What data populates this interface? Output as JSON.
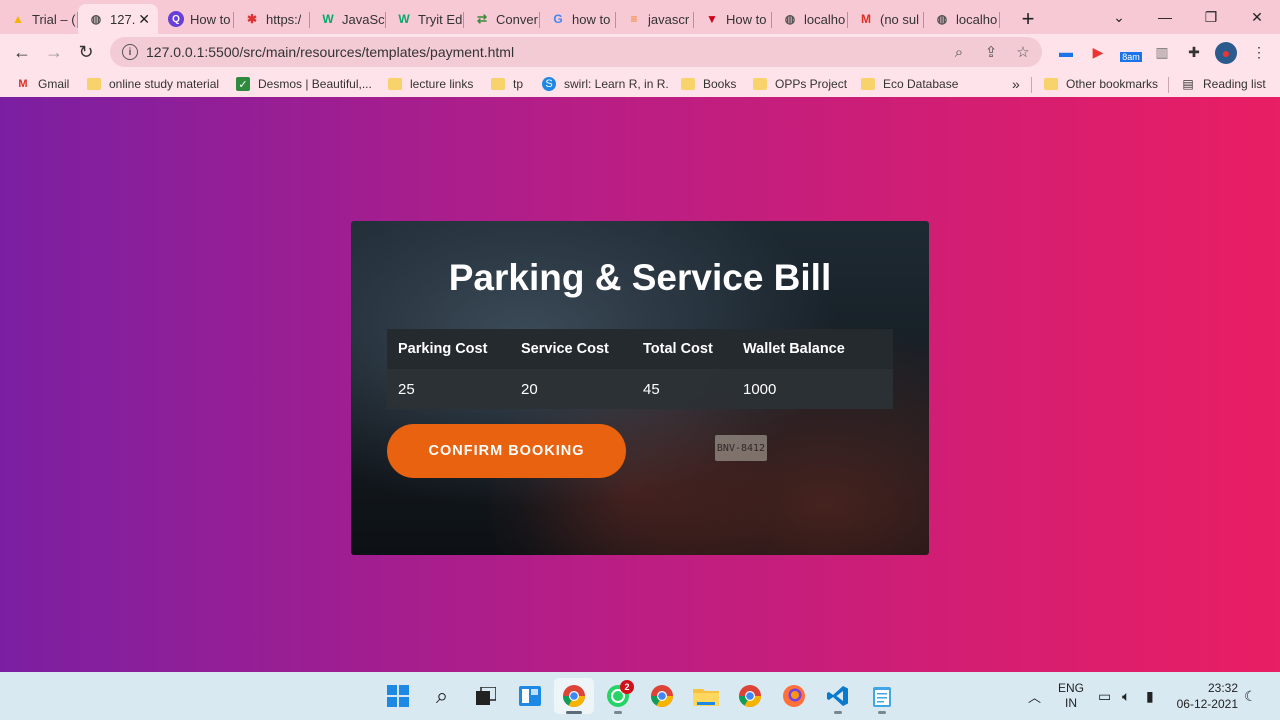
{
  "browser": {
    "tabs": [
      {
        "title": "Trial – (",
        "icon": "drive-icon"
      },
      {
        "title": "127.",
        "icon": "globe-icon",
        "active": true
      },
      {
        "title": "How to",
        "icon": "quora-icon"
      },
      {
        "title": "https:/",
        "icon": "react-icon"
      },
      {
        "title": "JavaSc",
        "icon": "w3schools-icon"
      },
      {
        "title": "Tryit Ed",
        "icon": "w3schools-icon"
      },
      {
        "title": "Conver",
        "icon": "converter-icon"
      },
      {
        "title": "how to",
        "icon": "google-icon"
      },
      {
        "title": "javascr",
        "icon": "stackoverflow-icon"
      },
      {
        "title": "How to",
        "icon": "vector-icon"
      },
      {
        "title": "localho",
        "icon": "globe-icon"
      },
      {
        "title": "(no sul",
        "icon": "gmail-icon"
      },
      {
        "title": "localho",
        "icon": "globe-icon"
      }
    ],
    "url": "127.0.0.1:5500/src/main/resources/templates/payment.html",
    "extension_badge": "8am",
    "bookmarks": [
      {
        "label": "Gmail",
        "icon": "gmail-icon"
      },
      {
        "label": "online study material",
        "icon": "folder-icon"
      },
      {
        "label": "Desmos | Beautiful,...",
        "icon": "desmos-icon"
      },
      {
        "label": "lecture links",
        "icon": "folder-icon"
      },
      {
        "label": "tp",
        "icon": "folder-icon"
      },
      {
        "label": "swirl: Learn R, in R.",
        "icon": "swirl-icon"
      },
      {
        "label": "Books",
        "icon": "folder-icon"
      },
      {
        "label": "OPPs Project",
        "icon": "folder-icon"
      },
      {
        "label": "Eco Database",
        "icon": "folder-icon"
      }
    ],
    "overflow_label": "»",
    "other_bookmarks": "Other bookmarks",
    "reading_list": "Reading list"
  },
  "page": {
    "title": "Parking & Service Bill",
    "table": {
      "headers": [
        "Parking Cost",
        "Service Cost",
        "Total Cost",
        "Wallet Balance"
      ],
      "row": [
        "25",
        "20",
        "45",
        "1000"
      ]
    },
    "confirm_button": "CONFIRM BOOKING",
    "plate_text": "BNV-8412",
    "colors": {
      "gradient_start": "#7b1fa2",
      "gradient_end": "#e91e63",
      "button": "#e8620f"
    }
  },
  "taskbar": {
    "whatsapp_badge": "2",
    "language": "ENG",
    "region": "IN",
    "time": "23:32",
    "date": "06-12-2021"
  }
}
